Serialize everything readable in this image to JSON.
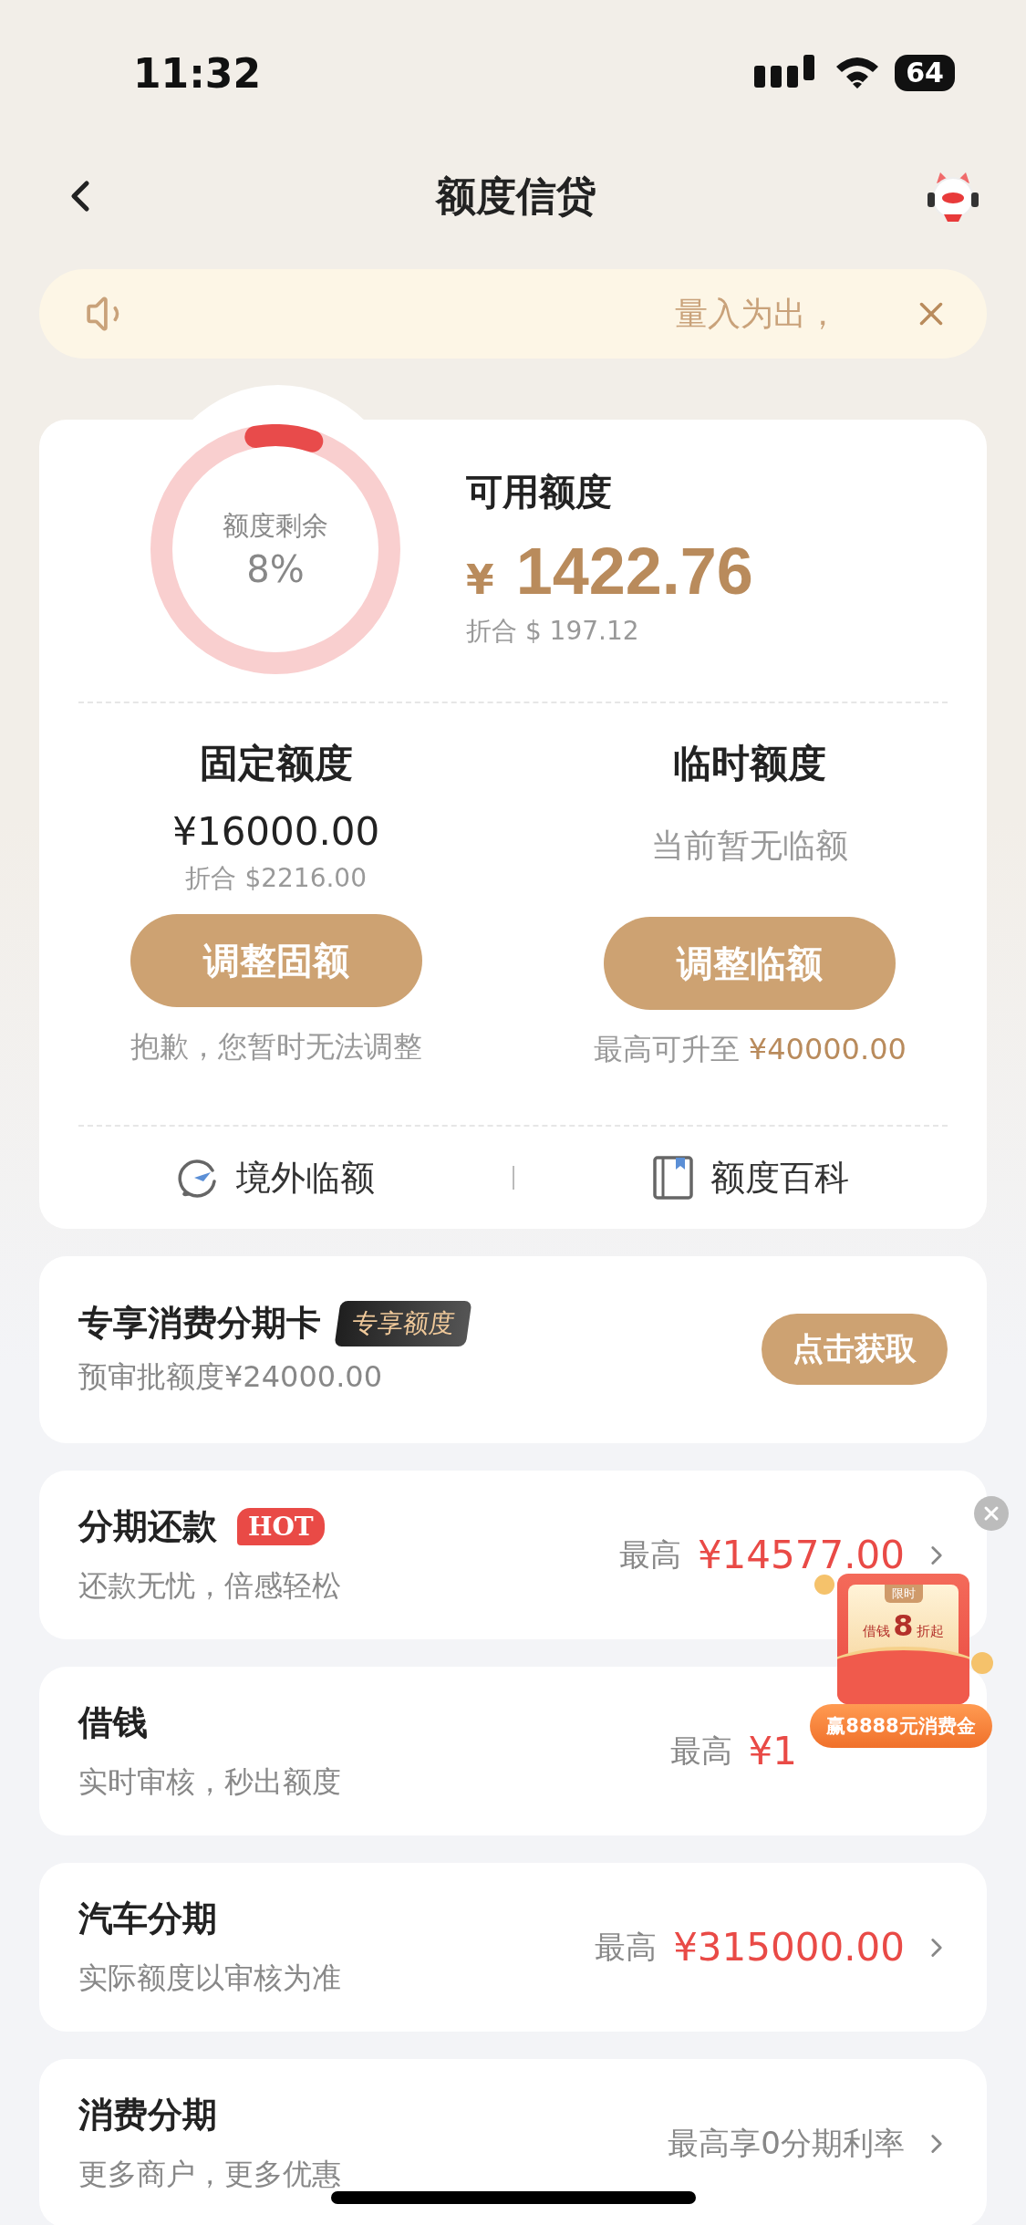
{
  "status_bar": {
    "time": "11:32",
    "battery": "64"
  },
  "nav": {
    "title": "额度信贷"
  },
  "notice": {
    "text": "量入为出，"
  },
  "credit": {
    "ring": {
      "label": "额度剩余",
      "reading": "8%",
      "level": 0.08
    },
    "title": "可用额度",
    "currency": "¥",
    "amount": "1422.76",
    "converted": "折合 $ 197.12",
    "columns": [
      {
        "title": "固定额度",
        "amount": "¥16000.00",
        "converted": "折合 $2216.00",
        "button": "调整固额",
        "note": "抱歉，您暂时无法调整"
      },
      {
        "title": "临时额度",
        "status": "当前暂无临额",
        "button": "调整临额",
        "note": "最高可升至 ",
        "note_highlight": "¥40000.00"
      }
    ],
    "links": [
      {
        "label": "境外临额",
        "kind": "plane"
      },
      {
        "label": "额度百科",
        "kind": "book"
      }
    ]
  },
  "card_offer": {
    "title": "专享消费分期卡",
    "tag": "专享额度",
    "subtitle": "预审批额度¥24000.00",
    "button": "点击获取"
  },
  "products": [
    {
      "title": "分期还款",
      "badge": "HOT",
      "subtitle": "还款无忧，倍感轻松",
      "prefix": "最高",
      "value": "¥14577.00",
      "chevron": true
    },
    {
      "title": "借钱",
      "subtitle": "实时审核，秒出额度",
      "prefix": "最高",
      "value": "¥1",
      "chevron": false
    },
    {
      "title": "汽车分期",
      "subtitle": "实际额度以审核为准",
      "prefix": "最高",
      "value": "¥315000.00",
      "chevron": true
    },
    {
      "title": "消费分期",
      "subtitle": "更多商户，更多优惠",
      "prefix": "最高享0分期利率",
      "chevron": true
    }
  ],
  "promo": {
    "tag": "限时",
    "line_start": "借钱",
    "number": "8",
    "line_end": "折起",
    "banner": "赢8888元消费金"
  }
}
